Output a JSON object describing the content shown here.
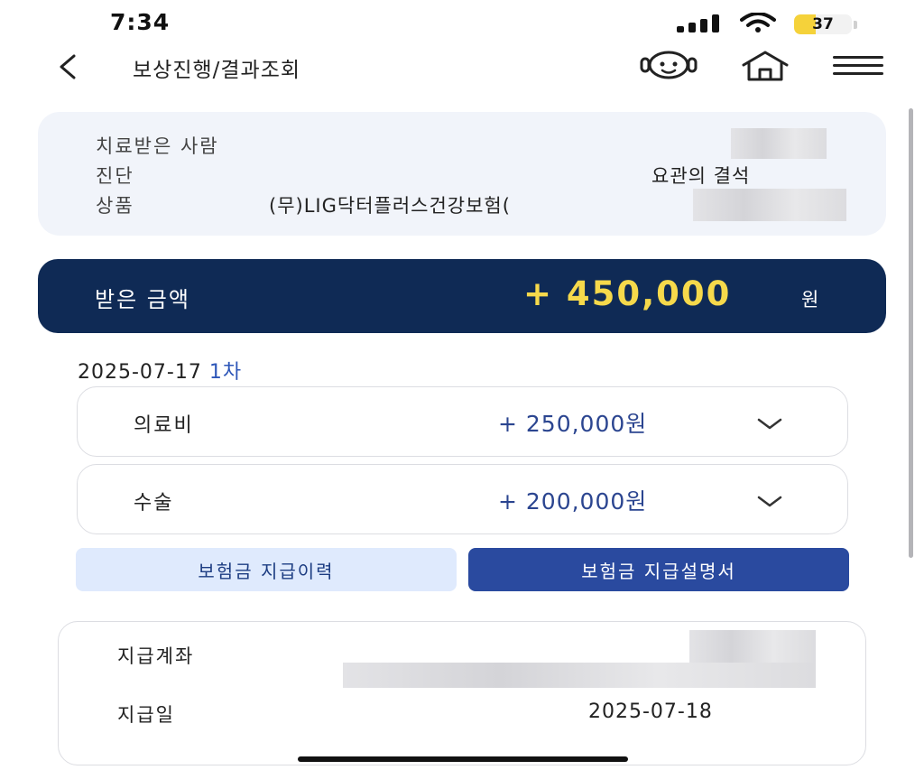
{
  "status_bar": {
    "time": "7:34",
    "battery_level": "37",
    "battery_fraction": 0.37,
    "battery_color": "#f5d23a"
  },
  "header": {
    "title": "보상진행/결과조회",
    "icons": [
      "back-chevron-icon",
      "chatbot-icon",
      "home-icon",
      "menu-icon"
    ]
  },
  "info": {
    "patient_label": "치료받은 사람",
    "diagnosis_label": "진단",
    "diagnosis_value": "요관의 결석",
    "product_label": "상품",
    "product_value": "(무)LIG닥터플러스건강보험("
  },
  "summary": {
    "label": "받은 금액",
    "amount": "+ 450,000",
    "unit": "원",
    "banner_color": "#0f2a55",
    "amount_color": "#f6d94b"
  },
  "payout": {
    "date": "2025-07-17",
    "round": "1차",
    "items": [
      {
        "label": "의료비",
        "amount": "+ 250,000원"
      },
      {
        "label": "수술",
        "amount": "+ 200,000원"
      }
    ]
  },
  "buttons": {
    "history": "보험금 지급이력",
    "statement": "보험금 지급설명서"
  },
  "account": {
    "account_label": "지급계좌",
    "pay_date_label": "지급일",
    "pay_date": "2025-07-18"
  }
}
